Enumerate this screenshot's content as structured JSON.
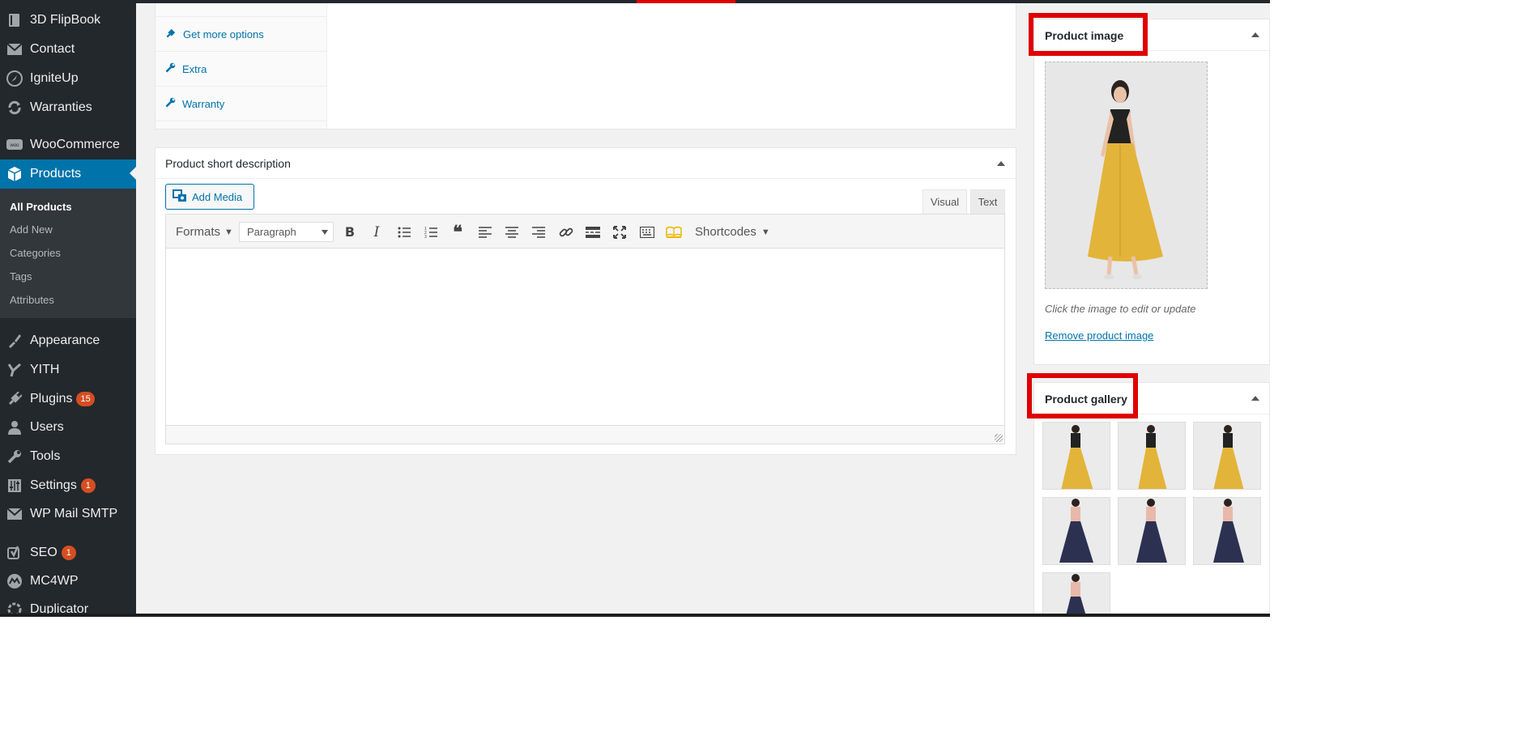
{
  "sidebar": {
    "items": [
      {
        "label": "3D FlipBook",
        "icon": "book-icon"
      },
      {
        "label": "Contact",
        "icon": "envelope-icon"
      },
      {
        "label": "IgniteUp",
        "icon": "rocket-icon"
      },
      {
        "label": "Warranties",
        "icon": "refresh-icon"
      },
      {
        "label": "WooCommerce",
        "icon": "woo-icon"
      },
      {
        "label": "Products",
        "icon": "cube-icon",
        "active": true
      },
      {
        "label": "Appearance",
        "icon": "brush-icon"
      },
      {
        "label": "YITH",
        "icon": "yith-icon"
      },
      {
        "label": "Plugins",
        "icon": "plug-icon",
        "badge": "15"
      },
      {
        "label": "Users",
        "icon": "user-icon"
      },
      {
        "label": "Tools",
        "icon": "wrench-icon"
      },
      {
        "label": "Settings",
        "icon": "sliders-icon",
        "badge": "1"
      },
      {
        "label": "WP Mail SMTP",
        "icon": "mail-icon"
      },
      {
        "label": "SEO",
        "icon": "yoast-icon",
        "badge": "1"
      },
      {
        "label": "MC4WP",
        "icon": "mc4wp-icon"
      },
      {
        "label": "Duplicator",
        "icon": "duplicator-icon"
      }
    ],
    "submenu": [
      "All Products",
      "Add New",
      "Categories",
      "Tags",
      "Attributes"
    ]
  },
  "product_data": {
    "tabs": [
      "Get more options",
      "Extra",
      "Warranty"
    ]
  },
  "short_description": {
    "title": "Product short description",
    "add_media": "Add Media",
    "tab_visual": "Visual",
    "tab_text": "Text",
    "formats": "Formats",
    "paragraph": "Paragraph",
    "shortcodes": "Shortcodes"
  },
  "product_image": {
    "title": "Product image",
    "hint": "Click the image to edit or update",
    "remove": "Remove product image"
  },
  "product_gallery": {
    "title": "Product gallery"
  },
  "colors": {
    "sidebar": "#23282d",
    "active": "#0073aa",
    "highlight": "#e00000",
    "badge": "#d54e21"
  }
}
